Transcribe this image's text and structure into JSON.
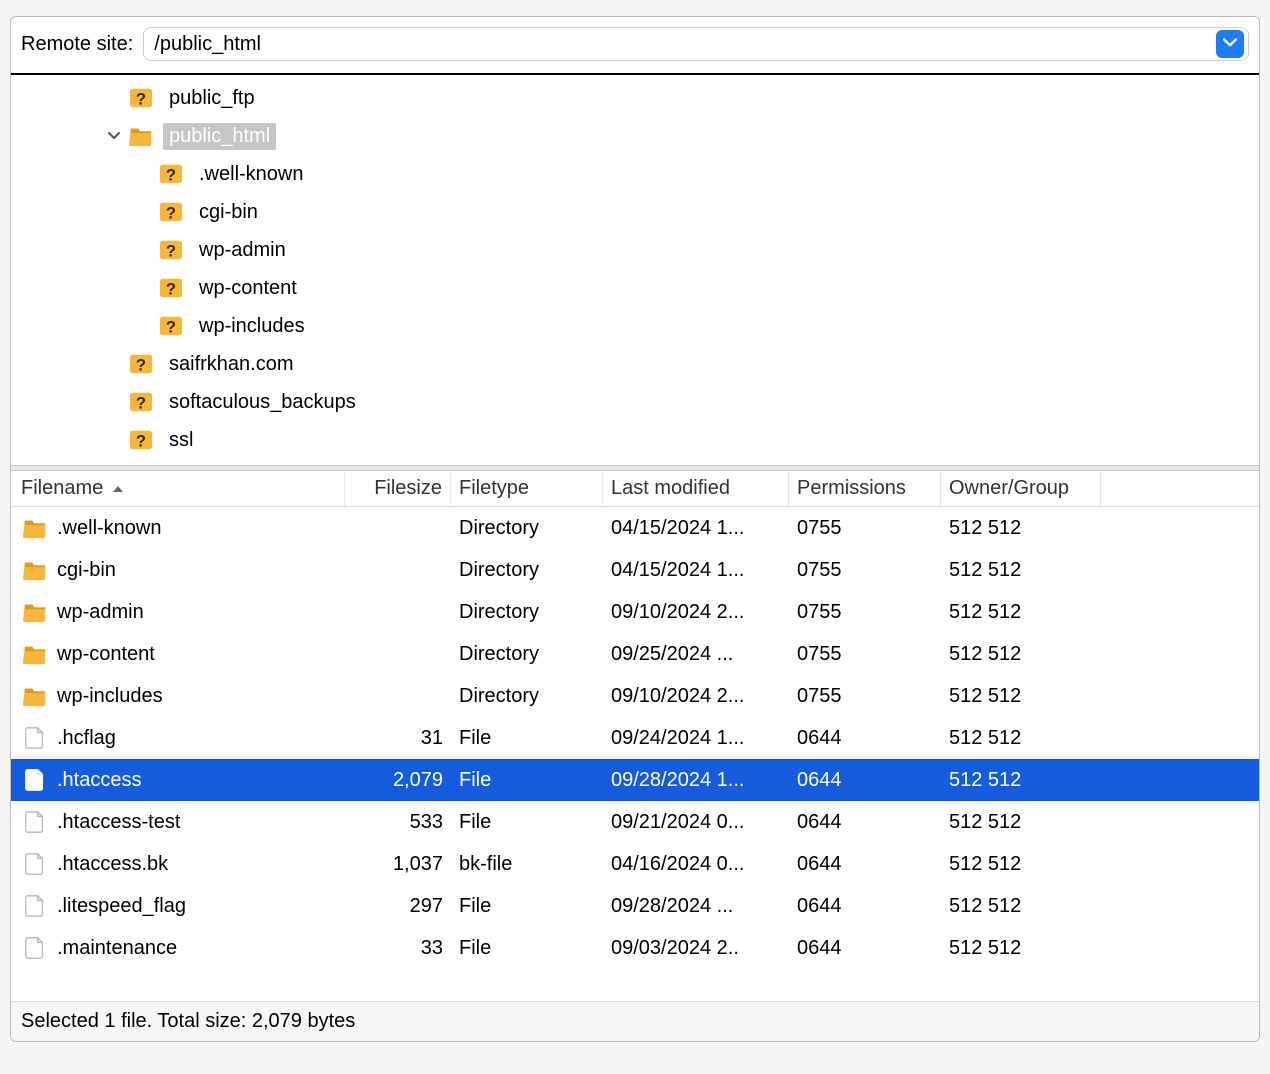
{
  "pathbar": {
    "label": "Remote site:",
    "value": "/public_html"
  },
  "tree": [
    {
      "depth": 3,
      "kind": "folderq",
      "label": "public_ftp"
    },
    {
      "depth": 3,
      "kind": "folder",
      "label": "public_html",
      "expanded": true,
      "selected": true
    },
    {
      "depth": 4,
      "kind": "folderq",
      "label": ".well-known"
    },
    {
      "depth": 4,
      "kind": "folderq",
      "label": "cgi-bin"
    },
    {
      "depth": 4,
      "kind": "folderq",
      "label": "wp-admin"
    },
    {
      "depth": 4,
      "kind": "folderq",
      "label": "wp-content"
    },
    {
      "depth": 4,
      "kind": "folderq",
      "label": "wp-includes"
    },
    {
      "depth": 3,
      "kind": "folderq",
      "label": "saifrkhan.com"
    },
    {
      "depth": 3,
      "kind": "folderq",
      "label": "softaculous_backups"
    },
    {
      "depth": 3,
      "kind": "folderq",
      "label": "ssl"
    },
    {
      "depth": 3,
      "kind": "folderq",
      "label": ""
    }
  ],
  "columns": {
    "filename": "Filename",
    "filesize": "Filesize",
    "filetype": "Filetype",
    "modified": "Last modified",
    "perms": "Permissions",
    "owner": "Owner/Group",
    "sort": "filename_asc"
  },
  "files": [
    {
      "kind": "folder",
      "name": ".well-known",
      "size": "",
      "type": "Directory",
      "modified": "04/15/2024 1...",
      "perms": "0755",
      "owner": "512 512"
    },
    {
      "kind": "folder",
      "name": "cgi-bin",
      "size": "",
      "type": "Directory",
      "modified": "04/15/2024 1...",
      "perms": "0755",
      "owner": "512 512"
    },
    {
      "kind": "folder",
      "name": "wp-admin",
      "size": "",
      "type": "Directory",
      "modified": "09/10/2024 2...",
      "perms": "0755",
      "owner": "512 512"
    },
    {
      "kind": "folder",
      "name": "wp-content",
      "size": "",
      "type": "Directory",
      "modified": "09/25/2024 ...",
      "perms": "0755",
      "owner": "512 512"
    },
    {
      "kind": "folder",
      "name": "wp-includes",
      "size": "",
      "type": "Directory",
      "modified": "09/10/2024 2...",
      "perms": "0755",
      "owner": "512 512"
    },
    {
      "kind": "file",
      "name": ".hcflag",
      "size": "31",
      "type": "File",
      "modified": "09/24/2024 1...",
      "perms": "0644",
      "owner": "512 512"
    },
    {
      "kind": "file",
      "name": ".htaccess",
      "size": "2,079",
      "type": "File",
      "modified": "09/28/2024 1...",
      "perms": "0644",
      "owner": "512 512",
      "selected": true
    },
    {
      "kind": "file",
      "name": ".htaccess-test",
      "size": "533",
      "type": "File",
      "modified": "09/21/2024 0...",
      "perms": "0644",
      "owner": "512 512"
    },
    {
      "kind": "file",
      "name": ".htaccess.bk",
      "size": "1,037",
      "type": "bk-file",
      "modified": "04/16/2024 0...",
      "perms": "0644",
      "owner": "512 512"
    },
    {
      "kind": "file",
      "name": ".litespeed_flag",
      "size": "297",
      "type": "File",
      "modified": "09/28/2024 ...",
      "perms": "0644",
      "owner": "512 512"
    },
    {
      "kind": "file",
      "name": ".maintenance",
      "size": "33",
      "type": "File",
      "modified": "09/03/2024 2..",
      "perms": "0644",
      "owner": "512 512"
    }
  ],
  "status": "Selected 1 file. Total size: 2,079 bytes"
}
